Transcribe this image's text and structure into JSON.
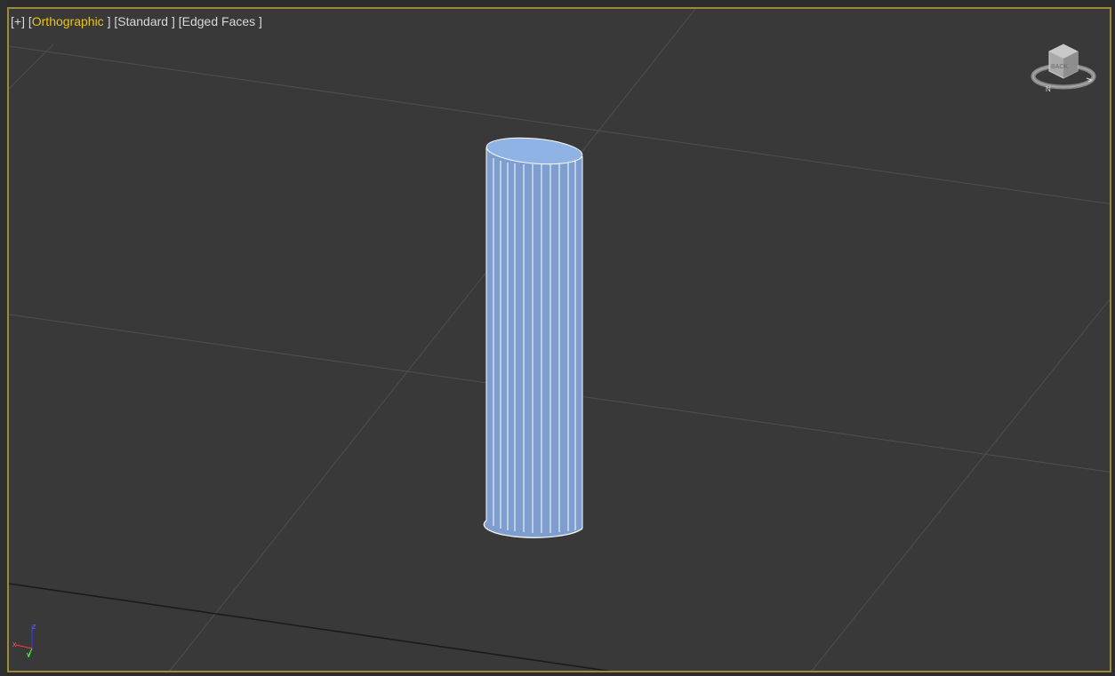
{
  "viewport": {
    "menu_label": "[+]",
    "view_label": "Orthographic",
    "shading_label": "Standard",
    "edge_label": "Edged Faces"
  },
  "viewcube": {
    "face_label": "BACK",
    "compass_label": "N"
  },
  "axis_tripod": {
    "x_label": "x",
    "y_label": "y",
    "z_label": "z"
  },
  "colors": {
    "background": "#393939",
    "grid": "#4f4f4f",
    "active_border": "#9c8a3a",
    "active_label": "#e8c61c",
    "object": "#8aaee0",
    "edges": "#ffffff"
  },
  "icons": [
    "viewcube-icon",
    "axis-tripod-icon"
  ]
}
